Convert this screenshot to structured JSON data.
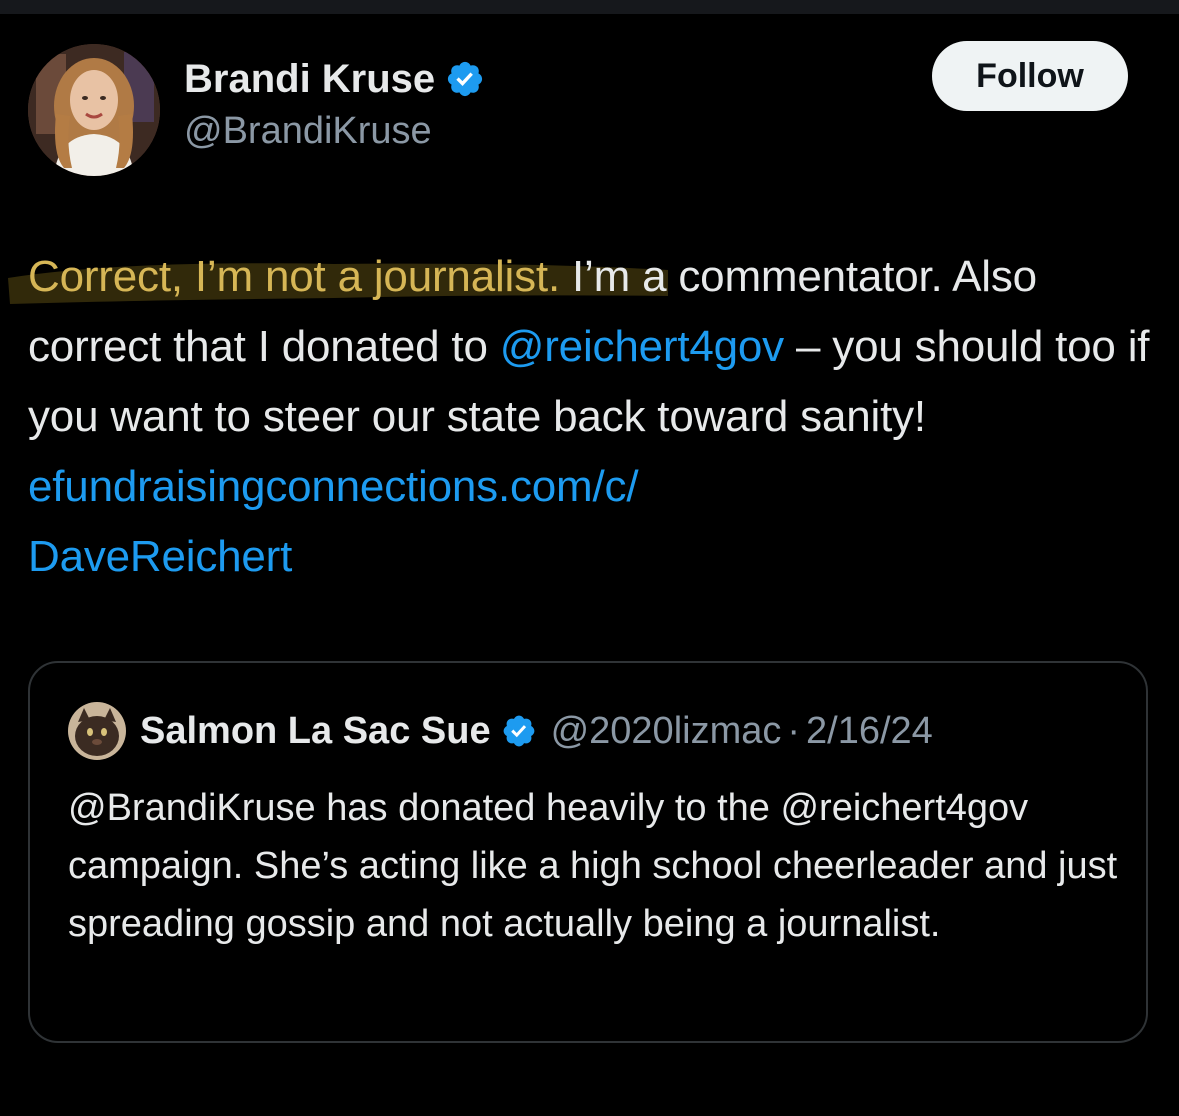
{
  "author": {
    "display_name": "Brandi Kruse",
    "handle": "@BrandiKruse",
    "verified_icon": "verified-badge-icon",
    "avatar_icon": "avatar"
  },
  "follow_button": {
    "label": "Follow"
  },
  "tweet": {
    "highlighted": "Correct, I’m not a journalist.",
    "text_1": " I’m a commentator. Also correct that I donated to ",
    "mention": "@reichert4gov",
    "text_2": " – you should too if you want to steer our state back toward sanity! ",
    "link_1": "efundraisingconnections.com/c/",
    "link_2": "DaveReichert"
  },
  "quoted_tweet": {
    "display_name": "Salmon La Sac Sue",
    "handle": "@2020lizmac",
    "separator": "·",
    "date": "2/16/24",
    "text": "@BrandiKruse has donated heavily to the @reichert4gov campaign. She’s acting like a high school cheerleader and just spreading gossip and not actually being a journalist."
  },
  "colors": {
    "background": "#000000",
    "text": "#e7e9ea",
    "secondary_text": "#8b98a5",
    "link": "#1d9bf0",
    "highlight_text": "#d6b656",
    "highlight_marker": "#5a4a12",
    "verified": "#1d9bf0",
    "follow_bg": "#eff3f4"
  }
}
